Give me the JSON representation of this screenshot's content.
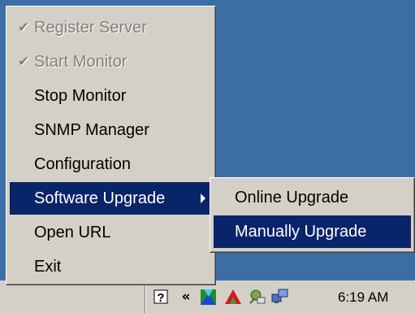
{
  "context_menu": {
    "items": [
      {
        "label": "Register Server",
        "state": "checked-disabled"
      },
      {
        "label": "Start Monitor",
        "state": "checked-disabled"
      },
      {
        "label": "Stop Monitor",
        "state": "enabled"
      },
      {
        "label": "SNMP Manager",
        "state": "enabled"
      },
      {
        "label": "Configuration",
        "state": "enabled"
      },
      {
        "label": "Software Upgrade",
        "state": "highlighted-submenu"
      },
      {
        "label": "Open URL",
        "state": "enabled"
      },
      {
        "label": "Exit",
        "state": "enabled"
      }
    ],
    "check_glyph": "✔"
  },
  "submenu": {
    "items": [
      {
        "label": "Online Upgrade",
        "state": "enabled"
      },
      {
        "label": "Manually Upgrade",
        "state": "highlighted"
      }
    ]
  },
  "taskbar": {
    "clock": "6:19 AM",
    "tray_icons": [
      "help-icon",
      "expand-tray-icon",
      "app-icon",
      "red-app-icon",
      "network-tool-icon",
      "network-connection-icon"
    ]
  },
  "colors": {
    "desktop": "#3c6ea5",
    "menu_face": "#d4d0c8",
    "highlight": "#0a246a"
  }
}
